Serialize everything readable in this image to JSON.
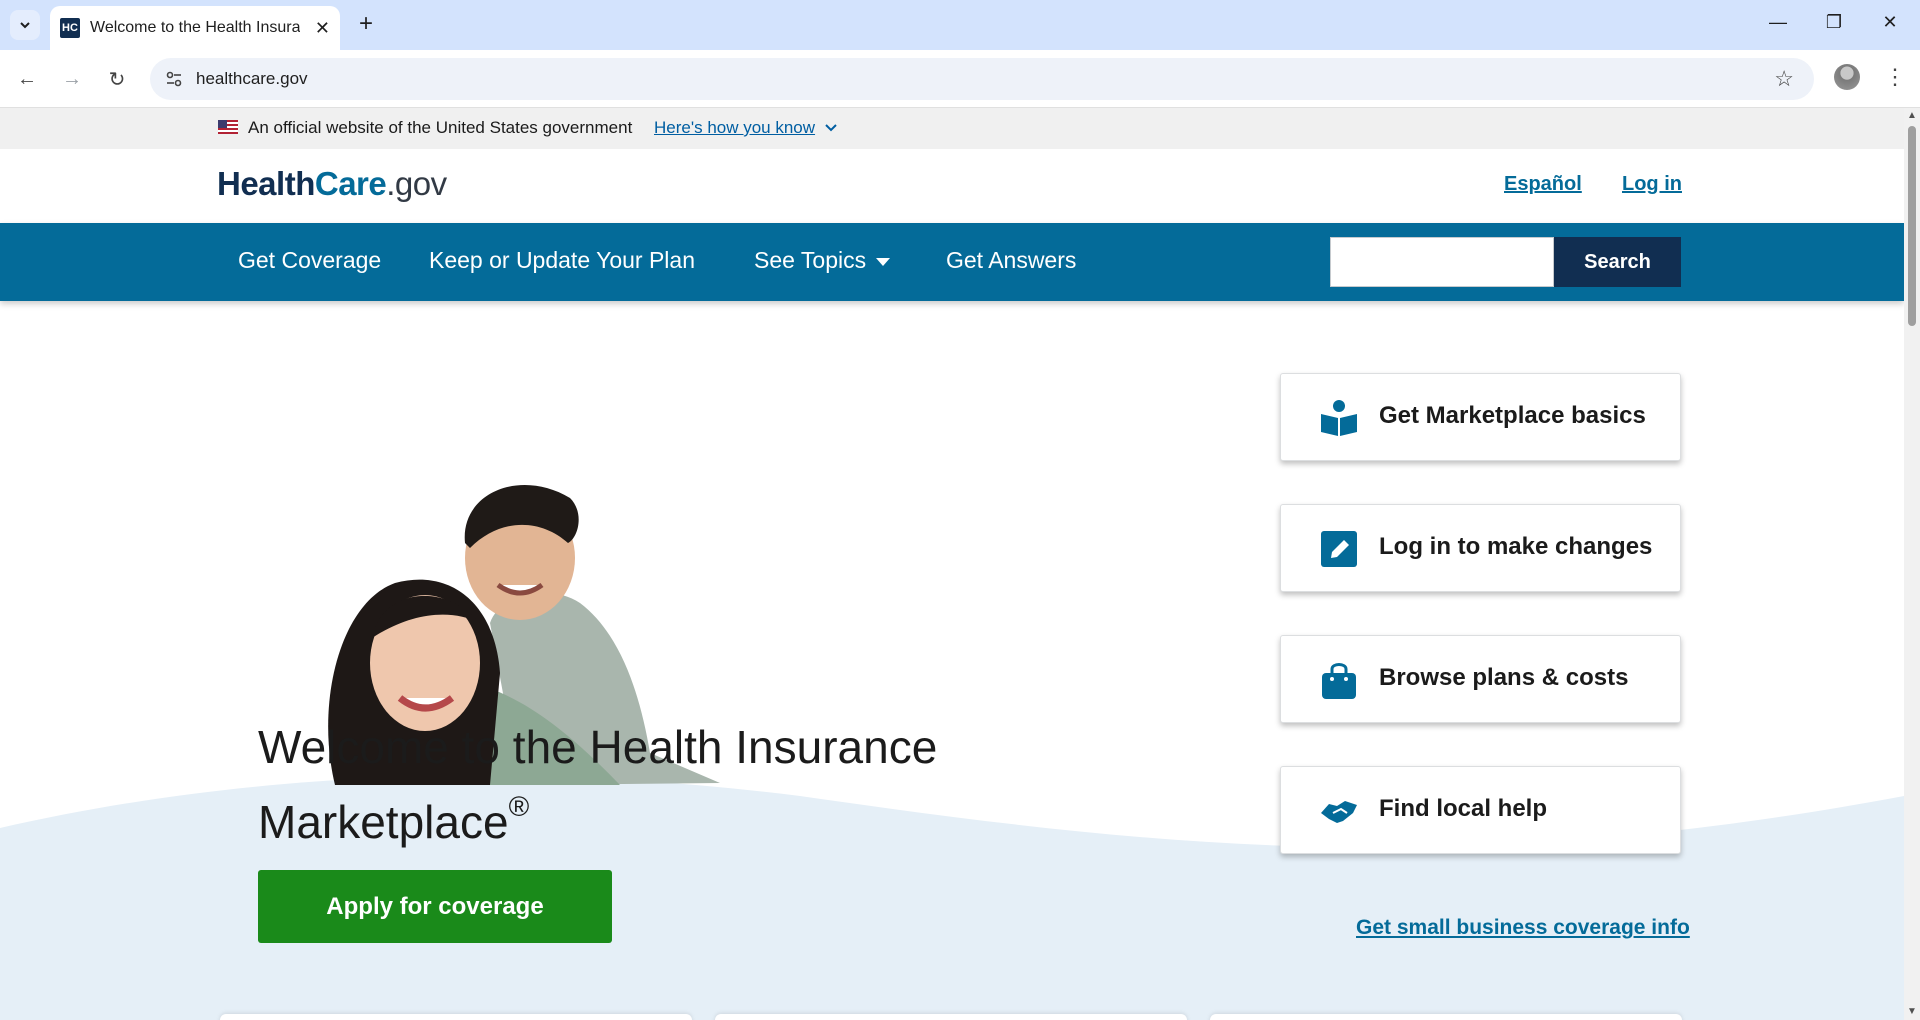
{
  "browser": {
    "tab_title": "Welcome to the Health Insurance Marketplace",
    "favicon_text": "HC",
    "url": "healthcare.gov"
  },
  "banner": {
    "text": "An official website of the United States government",
    "link": "Here's how you know"
  },
  "header": {
    "logo_part1": "Health",
    "logo_part2": "Care",
    "logo_part3": ".gov",
    "espanol": "Español",
    "login": "Log in"
  },
  "nav": {
    "items": [
      "Get Coverage",
      "Keep or Update Your Plan",
      "See Topics",
      "Get Answers"
    ],
    "search_button": "Search",
    "search_value": ""
  },
  "hero": {
    "title_line1": "Welcome to the Health Insurance",
    "title_line2": "Marketplace",
    "title_mark": "®",
    "apply_button": "Apply for coverage"
  },
  "cards": [
    {
      "label": "Get Marketplace basics",
      "icon": "reader-icon"
    },
    {
      "label": "Log in to make changes",
      "icon": "pencil-icon"
    },
    {
      "label": "Browse plans & costs",
      "icon": "shopping-bag-icon"
    },
    {
      "label": "Find local help",
      "icon": "handshake-icon"
    }
  ],
  "small_business_link": "Get small business coverage info",
  "colors": {
    "primary": "#046b99",
    "dark_navy": "#112e51",
    "apply_green": "#1a8a1a",
    "hero_wave": "#e5eff7"
  }
}
